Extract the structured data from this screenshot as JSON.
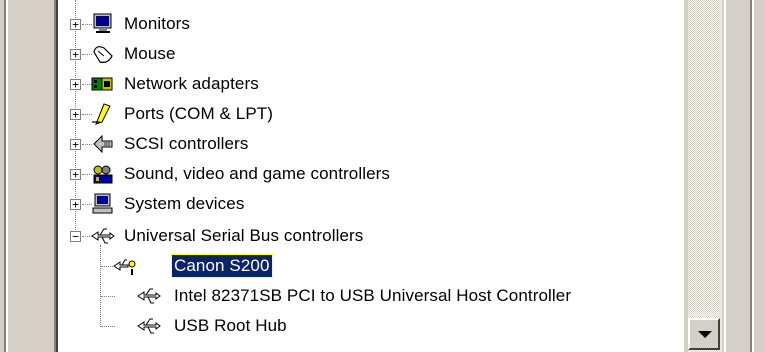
{
  "tree": {
    "items": [
      {
        "label": "Monitors",
        "icon": "monitor-icon",
        "expander": "+"
      },
      {
        "label": "Mouse",
        "icon": "mouse-icon",
        "expander": "+"
      },
      {
        "label": "Network adapters",
        "icon": "network-adapter-icon",
        "expander": "+"
      },
      {
        "label": "Ports (COM & LPT)",
        "icon": "port-icon",
        "expander": "+"
      },
      {
        "label": "SCSI controllers",
        "icon": "scsi-icon",
        "expander": "+"
      },
      {
        "label": "Sound, video and game controllers",
        "icon": "sound-icon",
        "expander": "+"
      },
      {
        "label": "System devices",
        "icon": "computer-icon",
        "expander": "+"
      },
      {
        "label": "Universal Serial Bus controllers",
        "icon": "usb-icon",
        "expander": "−"
      }
    ],
    "children": [
      {
        "label": "Canon S200",
        "icon": "usb-warning-icon",
        "selected": true
      },
      {
        "label": "Intel 82371SB PCI to USB Universal Host Controller",
        "icon": "usb-icon"
      },
      {
        "label": "USB Root Hub",
        "icon": "usb-icon"
      }
    ]
  },
  "colors": {
    "selection": "#0a246a",
    "chrome": "#d4d0c8"
  }
}
